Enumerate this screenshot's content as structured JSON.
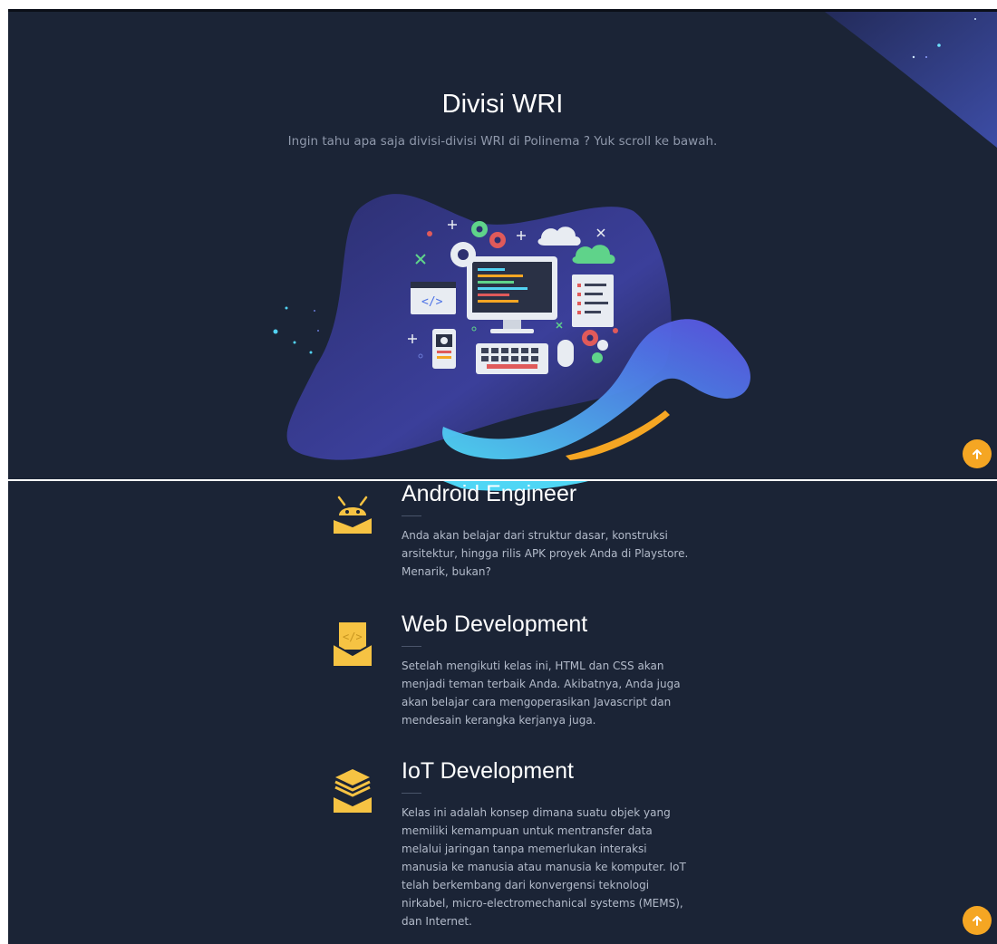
{
  "hero": {
    "title": "Divisi WRI",
    "subtitle": "Ingin tahu apa saja divisi-divisi WRI di Polinema ? Yuk scroll ke bawah.",
    "illustration_icon": "computer-development-illustration"
  },
  "divisions": [
    {
      "title": "Android Engineer",
      "description": "Anda akan belajar dari struktur dasar, konstruksi arsitektur, hingga rilis APK proyek Anda di Playstore. Menarik, bukan?",
      "icon": "android-icon"
    },
    {
      "title": "Web Development",
      "description": "Setelah mengikuti kelas ini, HTML dan CSS akan menjadi teman terbaik Anda. Akibatnya, Anda juga akan belajar cara mengoperasikan Javascript dan mendesain kerangka kerjanya juga.",
      "icon": "code-envelope-icon"
    },
    {
      "title": "IoT Development",
      "description": "Kelas ini adalah konsep dimana suatu objek yang memiliki kemampuan untuk mentransfer data melalui jaringan tanpa memerlukan interaksi manusia ke manusia atau manusia ke komputer. IoT telah berkembang dari konvergensi teknologi nirkabel, micro-electromechanical systems (MEMS), dan Internet.",
      "icon": "layers-stack-icon"
    }
  ],
  "scroll_top_icon": "arrow-up-icon",
  "colors": {
    "background": "#1b2436",
    "accent": "#f5a623",
    "icon_gold": "#f6c343",
    "blob": "#3b3f9a",
    "stroke_cyan": "#52d2f2"
  }
}
